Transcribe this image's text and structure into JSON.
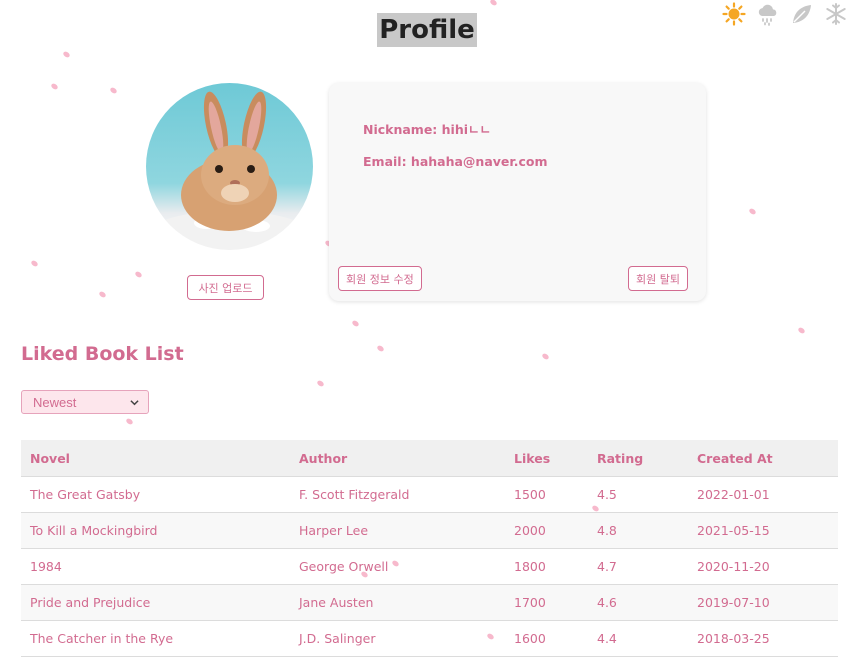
{
  "page": {
    "title": "Profile"
  },
  "weather_icons": [
    "sun-icon",
    "rain-cloud-icon",
    "leaf-icon",
    "snowflake-icon"
  ],
  "colors": {
    "accent": "#d26b90",
    "petal": "#f7b9cc",
    "sun": "#f5a623"
  },
  "profile": {
    "avatar_alt": "rabbit-photo",
    "upload_label": "사진 업로드",
    "nickname_line": "Nickname: hihiㄴㄴ",
    "email_line": "Email: hahaha@naver.com",
    "edit_label": "회원 정보 수정",
    "withdraw_label": "회원 탈퇴"
  },
  "liked": {
    "title": "Liked Book List",
    "sort_value": "Newest"
  },
  "table": {
    "headers": [
      "Novel",
      "Author",
      "Likes",
      "Rating",
      "Created At"
    ],
    "rows": [
      [
        "The Great Gatsby",
        "F. Scott Fitzgerald",
        "1500",
        "4.5",
        "2022-01-01"
      ],
      [
        "To Kill a Mockingbird",
        "Harper Lee",
        "2000",
        "4.8",
        "2021-05-15"
      ],
      [
        "1984",
        "George Orwell",
        "1800",
        "4.7",
        "2020-11-20"
      ],
      [
        "Pride and Prejudice",
        "Jane Austen",
        "1700",
        "4.6",
        "2019-07-10"
      ],
      [
        "The Catcher in the Rye",
        "J.D. Salinger",
        "1600",
        "4.4",
        "2018-03-25"
      ]
    ]
  }
}
